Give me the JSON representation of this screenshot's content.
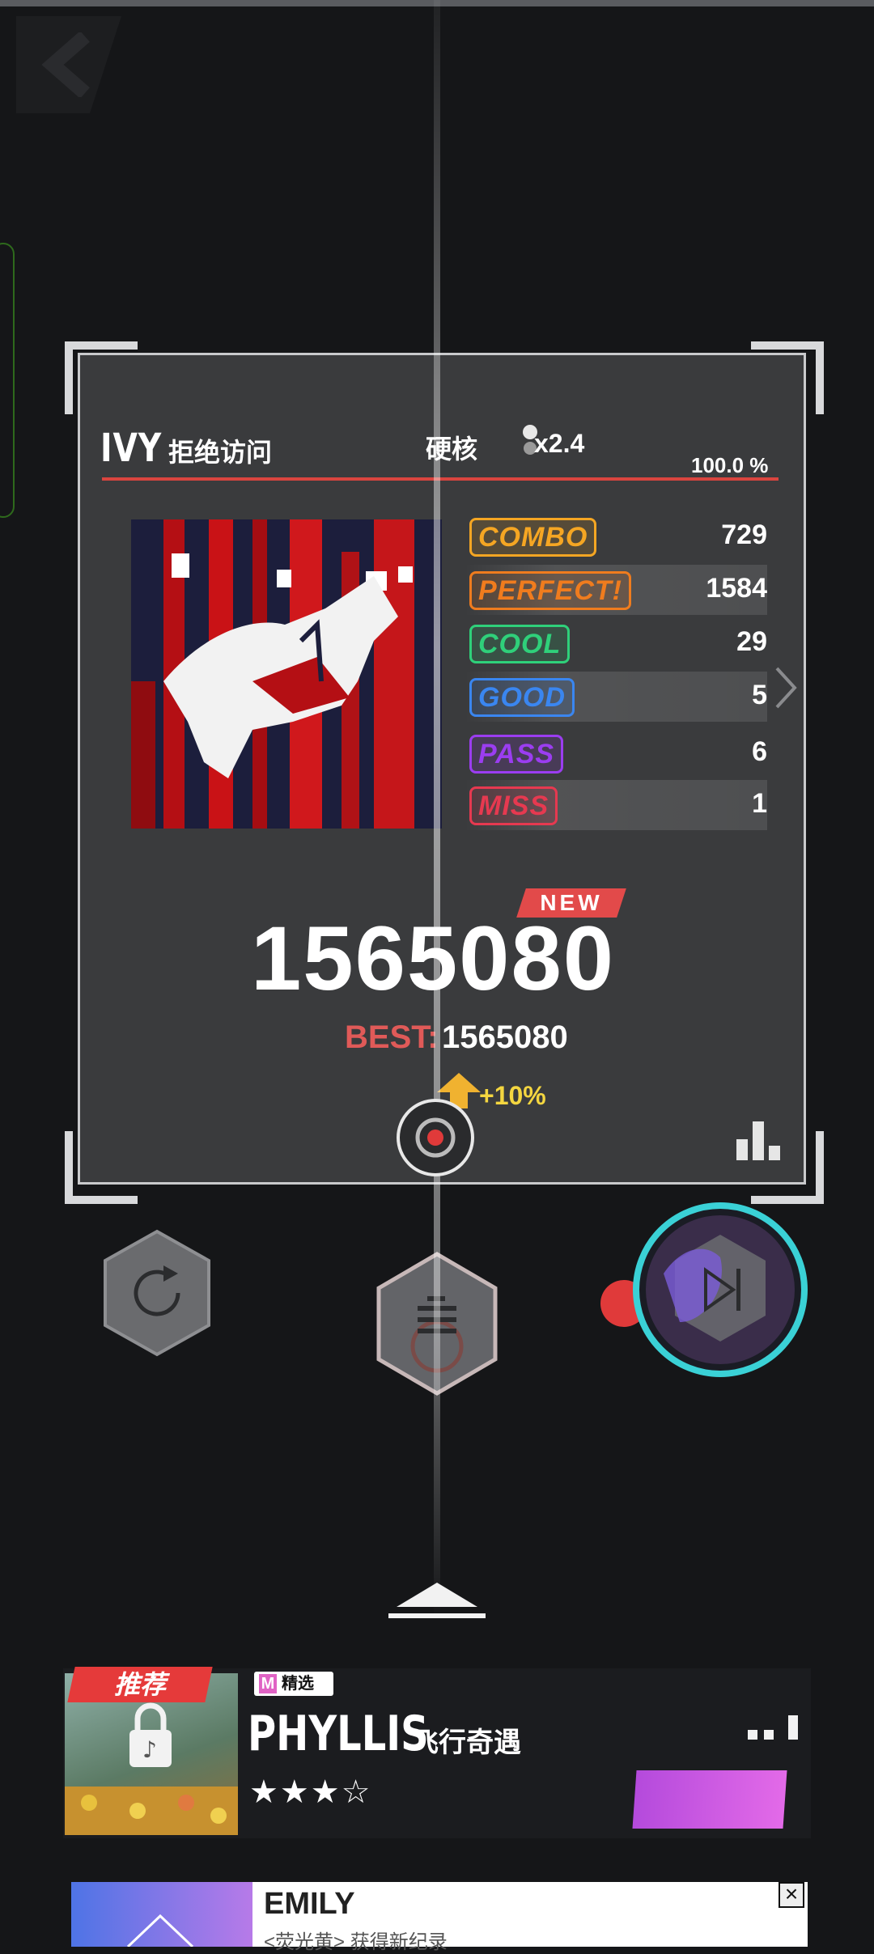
{
  "song": {
    "artist": "IVY",
    "title": "拒绝访问",
    "difficulty": "硬核",
    "speed": "x2.4",
    "accuracy": "100.0 %"
  },
  "stats": [
    {
      "label": "COMBO",
      "value": "729",
      "color": "#f5a623"
    },
    {
      "label": "PERFECT!",
      "value": "1584",
      "color": "#f07c1e"
    },
    {
      "label": "COOL",
      "value": "29",
      "color": "#2fd07a"
    },
    {
      "label": "GOOD",
      "value": "5",
      "color": "#3a86f0"
    },
    {
      "label": "PASS",
      "value": "6",
      "color": "#9b3df0"
    },
    {
      "label": "MISS",
      "value": "1",
      "color": "#e63950"
    }
  ],
  "result": {
    "new_label": "NEW",
    "score": "1565080",
    "best_label": "BEST:",
    "best_value": "1565080",
    "bonus": "+10%"
  },
  "recommend": {
    "tag": "推荐",
    "badge_letter": "M",
    "badge_text": "精选",
    "artist": "PHYLLIS",
    "title": "飞行奇遇",
    "stars": "★★★☆",
    "rating_value": 3.5
  },
  "ad": {
    "title": "EMILY",
    "subtitle": "<荧光黄> 获得新纪录"
  },
  "icons": {
    "retry": "retry-icon",
    "menu": "list-icon",
    "next": "skip-next-icon",
    "chart": "bar-chart-icon",
    "record": "record-icon"
  }
}
